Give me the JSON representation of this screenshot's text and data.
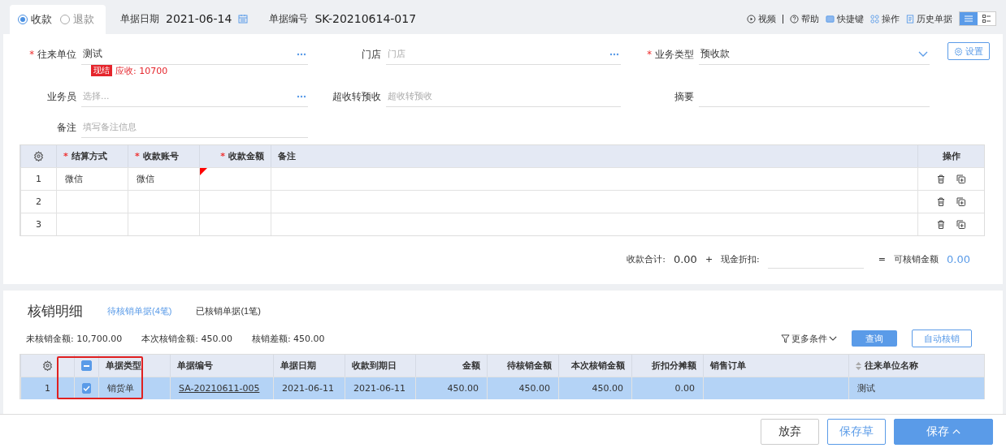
{
  "required_mark": "*",
  "header": {
    "modes": [
      {
        "label": "收款",
        "selected": true
      },
      {
        "label": "退款",
        "selected": false
      }
    ],
    "date_label": "单据日期",
    "date": "2021-06-14",
    "number_label": "单据编号",
    "number": "SK-20210614-017",
    "tools": [
      {
        "kind": "video",
        "label": "视频"
      },
      {
        "kind": "help",
        "label": "帮助"
      },
      {
        "kind": "shortcut",
        "label": "快捷键"
      },
      {
        "kind": "operate",
        "label": "操作"
      },
      {
        "kind": "history",
        "label": "历史单据"
      }
    ],
    "views": [
      {
        "kind": "list",
        "selected": true
      },
      {
        "kind": "detail",
        "selected": false
      }
    ]
  },
  "form": {
    "rows": [
      [
        {
          "label": "往来单位",
          "required": true,
          "kind": "lookup",
          "value": "测试"
        },
        {
          "label": "门店",
          "required": false,
          "kind": "lookup",
          "placeholder": "门店"
        },
        {
          "label": "业务类型",
          "required": true,
          "kind": "dropdown",
          "value": "预收款"
        }
      ],
      [
        {
          "label": "业务员",
          "required": false,
          "kind": "lookup",
          "placeholder": "选择..."
        },
        {
          "label": "超收转预收",
          "required": false,
          "kind": "text",
          "placeholder": "超收转预收"
        },
        {
          "label": "摘要",
          "required": false,
          "kind": "text"
        }
      ],
      [
        {
          "label": "备注",
          "required": false,
          "kind": "text",
          "placeholder": "填写备注信息"
        }
      ]
    ],
    "badge": "现结",
    "receivable": "应收: 10700",
    "settings": "设置"
  },
  "payments": {
    "columns": [
      {
        "label": "结算方式",
        "required": true
      },
      {
        "label": "收款账号",
        "required": true
      },
      {
        "label": "收款金额",
        "required": true
      },
      {
        "label": "备注",
        "required": false
      }
    ],
    "actions_label": "操作",
    "rows": [
      {
        "no": "1",
        "cells": [
          "微信",
          "微信",
          "",
          ""
        ],
        "flagged": true
      },
      {
        "no": "2",
        "cells": [
          "",
          "",
          "",
          ""
        ],
        "flagged": false
      },
      {
        "no": "3",
        "cells": [
          "",
          "",
          "",
          ""
        ],
        "flagged": false
      }
    ]
  },
  "totals": {
    "sum_label": "收款合计:",
    "sum": "0.00",
    "plus": "+",
    "discount_label": "现金折扣:",
    "equals": "=",
    "available_label": "可核销金额",
    "available": "0.00"
  },
  "writeoff": {
    "title": "核销明细",
    "tabs": [
      {
        "label": "待核销单据(4笔)",
        "selected": true
      },
      {
        "label": "已核销单据(1笔)",
        "selected": false
      }
    ],
    "summary": [
      "未核销金额: 10,700.00",
      "本次核销金额: 450.00",
      "核销差额: 450.00"
    ],
    "filter": "更多条件",
    "query": "查询",
    "auto": "自动核销",
    "header_partial": true,
    "columns": [
      "单据类型",
      "单据编号",
      "单据日期",
      "收款到期日",
      "金额",
      "待核销金额",
      "本次核销金额",
      "折扣分摊额",
      "销售订单",
      "往来单位名称"
    ],
    "rows": [
      {
        "no": "1",
        "checked": true,
        "selected": true,
        "cells": [
          "销货单",
          "SA-20210611-005",
          "2021-06-11",
          "2021-06-11",
          "450.00",
          "450.00",
          "450.00",
          "0.00",
          "",
          "测试"
        ]
      }
    ]
  },
  "footer": {
    "buttons": [
      {
        "kind": "plain",
        "label": "放弃"
      },
      {
        "kind": "outline",
        "label": "保存草"
      },
      {
        "kind": "primary",
        "label": "保存"
      }
    ]
  }
}
